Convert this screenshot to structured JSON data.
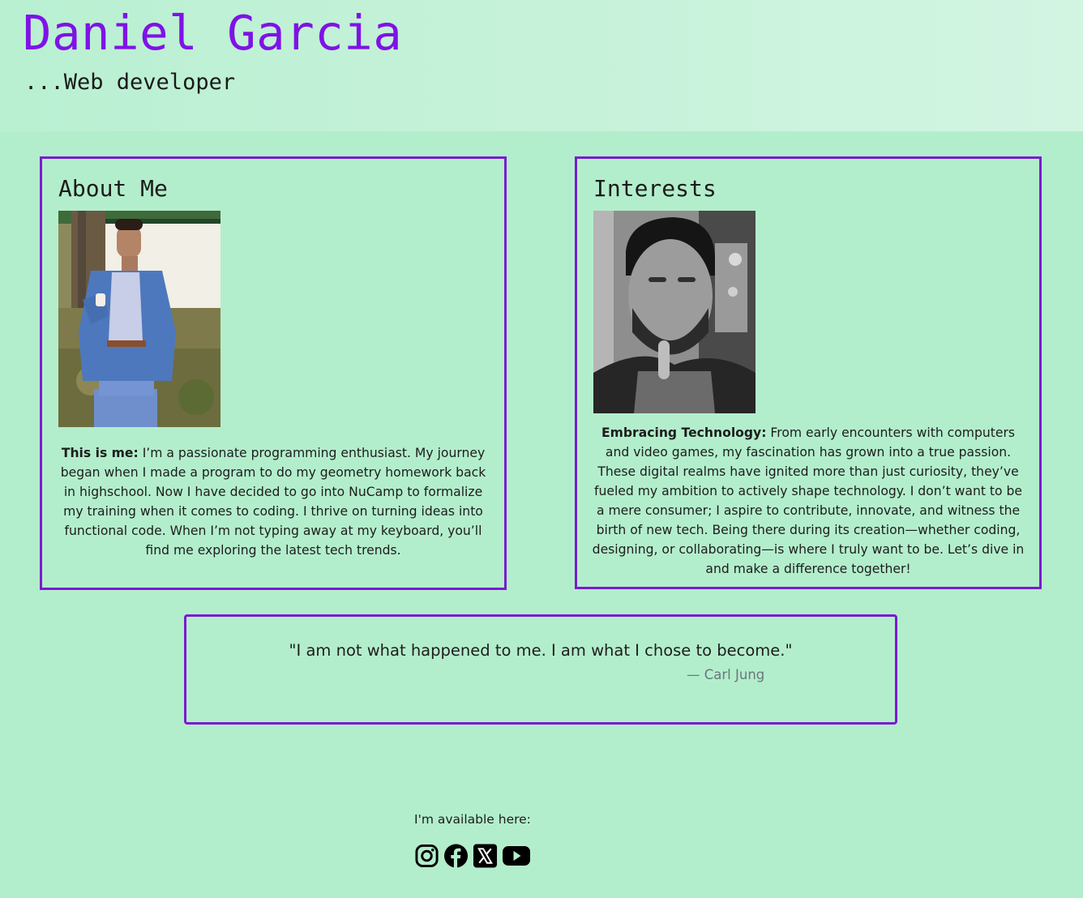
{
  "header": {
    "name": "Daniel Garcia",
    "tagline": "...Web developer"
  },
  "about": {
    "title": "About Me",
    "photo_alt": "Daniel Garcia standing outdoors in a blue suit",
    "intro_bold": "This is me:",
    "body": " I’m a passionate programming enthusiast. My journey began when I made a program to do my geometry homework back in highschool. Now I have decided to go into NuCamp to formalize my training when it comes to coding. I thrive on turning ideas into functional code. When I’m not typing away at my keyboard, you’ll find me exploring the latest tech trends."
  },
  "interests": {
    "title": "Interests",
    "photo_alt": "Black and white portrait of Daniel Garcia",
    "intro_bold": "Embracing Technology:",
    "body": " From early encounters with computers and video games, my fascination has grown into a true passion. These digital realms have ignited more than just curiosity, they’ve fueled my ambition to actively shape technology. I don’t want to be a mere consumer; I aspire to contribute, innovate, and witness the birth of new tech. Being there during its creation—whether coding, designing, or collaborating—is where I truly want to be. Let’s dive in and make a difference together!"
  },
  "quote": {
    "text": "\"I am not what happened to me. I am what I chose to become.\"",
    "author": "— Carl Jung"
  },
  "footer": {
    "label": "I'm available here:",
    "links": [
      {
        "icon": "instagram-icon",
        "label": "Instagram"
      },
      {
        "icon": "facebook-icon",
        "label": "Facebook"
      },
      {
        "icon": "x-twitter-icon",
        "label": "X"
      },
      {
        "icon": "youtube-icon",
        "label": "YouTube"
      }
    ]
  },
  "colors": {
    "background": "#b3eecc",
    "accent": "#7a1bd2",
    "name": "#7f12e6",
    "cite": "#6c757d"
  }
}
